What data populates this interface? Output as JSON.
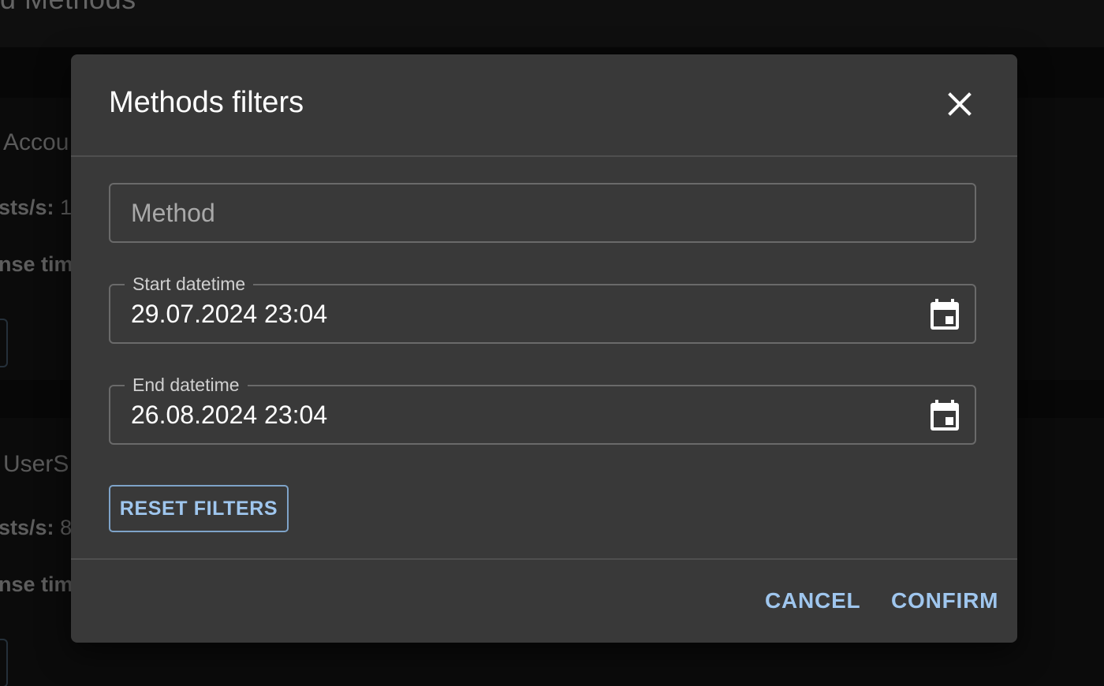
{
  "background": {
    "page_title": "d Methods",
    "cards": [
      {
        "title": "Accou",
        "line1_label": "sts/s:",
        "line1_value": "1(",
        "line2_label": "nse tim"
      },
      {
        "title": "UserS",
        "line1_label": "sts/s:",
        "line1_value": "8:",
        "line2_label": "nse tim"
      }
    ]
  },
  "dialog": {
    "title": "Methods filters",
    "close_icon": "close-icon",
    "method_field": {
      "placeholder": "Method",
      "value": ""
    },
    "start_field": {
      "label": "Start datetime",
      "value": "29.07.2024 23:04",
      "icon": "calendar-icon"
    },
    "end_field": {
      "label": "End datetime",
      "value": "26.08.2024 23:04",
      "icon": "calendar-icon"
    },
    "reset_label": "RESET FILTERS",
    "cancel_label": "CANCEL",
    "confirm_label": "CONFIRM"
  },
  "colors": {
    "dialog_bg": "#393939",
    "accent": "#9fc6ee",
    "backdrop": "#0b0b0b"
  }
}
